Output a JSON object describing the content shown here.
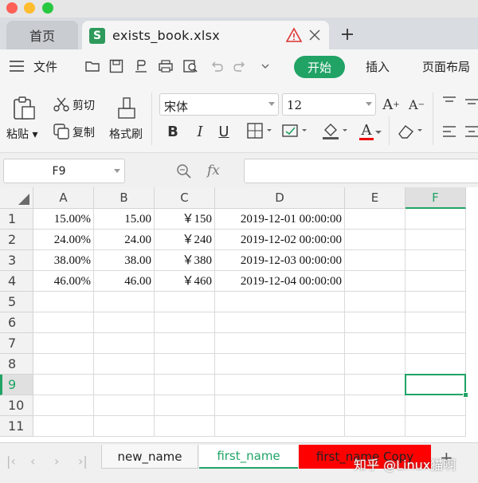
{
  "tabs": {
    "home_label": "首页",
    "file_name": "exists_book.xlsx",
    "file_icon_letter": "S"
  },
  "menu": {
    "file": "文件",
    "start": "开始",
    "insert": "插入",
    "page_layout": "页面布局"
  },
  "ribbon": {
    "paste": "粘贴",
    "cut": "剪切",
    "copy": "复制",
    "format_painter": "格式刷",
    "font_name": "宋体",
    "font_size": "12",
    "bold": "B",
    "italic": "I",
    "underline": "U",
    "grow_font": "A",
    "shrink_font": "A",
    "font_color_letter": "A"
  },
  "formula_bar": {
    "cell_ref": "F9",
    "fx": "fx",
    "value": ""
  },
  "sheet": {
    "columns": [
      "A",
      "B",
      "C",
      "D",
      "E",
      "F"
    ],
    "selected_column": "F",
    "row_numbers": [
      "1",
      "2",
      "3",
      "4",
      "5",
      "6",
      "7",
      "8",
      "9",
      "10",
      "11"
    ],
    "selected_row": "9",
    "rows": [
      [
        "15.00%",
        "15.00",
        "￥150",
        "2019-12-01 00:00:00",
        "",
        ""
      ],
      [
        "24.00%",
        "24.00",
        "￥240",
        "2019-12-02 00:00:00",
        "",
        ""
      ],
      [
        "38.00%",
        "38.00",
        "￥380",
        "2019-12-03 00:00:00",
        "",
        ""
      ],
      [
        "46.00%",
        "46.00",
        "￥460",
        "2019-12-04 00:00:00",
        "",
        ""
      ]
    ],
    "selected_cell": "F9"
  },
  "sheet_tabs": [
    {
      "label": "new_name"
    },
    {
      "label": "first_name"
    },
    {
      "label": "first_name Copy"
    }
  ],
  "watermark": "知乎 @Linux猫啊",
  "colors": {
    "accent": "#21a366",
    "red_tab": "#ff0000"
  },
  "icons": [
    "folder-icon",
    "save-icon",
    "print-icon",
    "undo-icon",
    "redo-icon",
    "warning-icon",
    "close-icon",
    "add-tab-icon",
    "paste-icon",
    "scissors-icon",
    "copy-icon",
    "brush-icon",
    "borders-icon",
    "fill-icon",
    "eraser-icon",
    "align-icon",
    "zoom-icon"
  ]
}
